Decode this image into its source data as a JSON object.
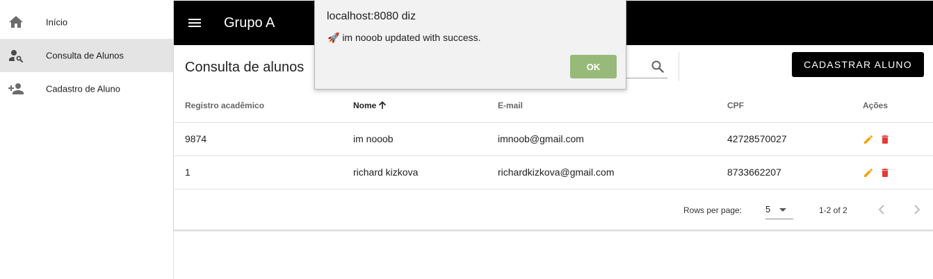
{
  "sidebar": {
    "items": [
      {
        "label": "Início",
        "icon": "home-icon"
      },
      {
        "label": "Consulta de Alunos",
        "icon": "person-search-icon",
        "active": true
      },
      {
        "label": "Cadastro de Aluno",
        "icon": "person-add-icon"
      }
    ]
  },
  "appbar": {
    "title": "Grupo A",
    "menu_icon": "menu-icon"
  },
  "main": {
    "title": "Consulta de alunos",
    "search_icon": "search-icon",
    "add_button": "Cadastrar aluno",
    "table": {
      "headers": [
        "Registro acadêmico",
        "Nome",
        "E-mail",
        "CPF",
        "Ações"
      ],
      "sorted_column": "Nome",
      "rows": [
        {
          "registro": "9874",
          "nome": "im nooob",
          "email": "imnoob@gmail.com",
          "cpf": "42728570027"
        },
        {
          "registro": "1",
          "nome": "richard kizkova",
          "email": "richardkizkova@gmail.com",
          "cpf": "8733662207"
        }
      ]
    },
    "pagination": {
      "rows_per_page_label": "Rows per page:",
      "rows_per_page": "5",
      "range": "1-2 of 2"
    }
  },
  "dialog": {
    "title": "localhost:8080 diz",
    "message": "🚀 im nooob updated with success.",
    "ok": "OK"
  },
  "colors": {
    "appbar": "#000000",
    "edit_icon": "#f5a000",
    "delete_icon": "#e53935",
    "ok_button": "#97b97a",
    "active_nav": "#e4e4e4"
  }
}
